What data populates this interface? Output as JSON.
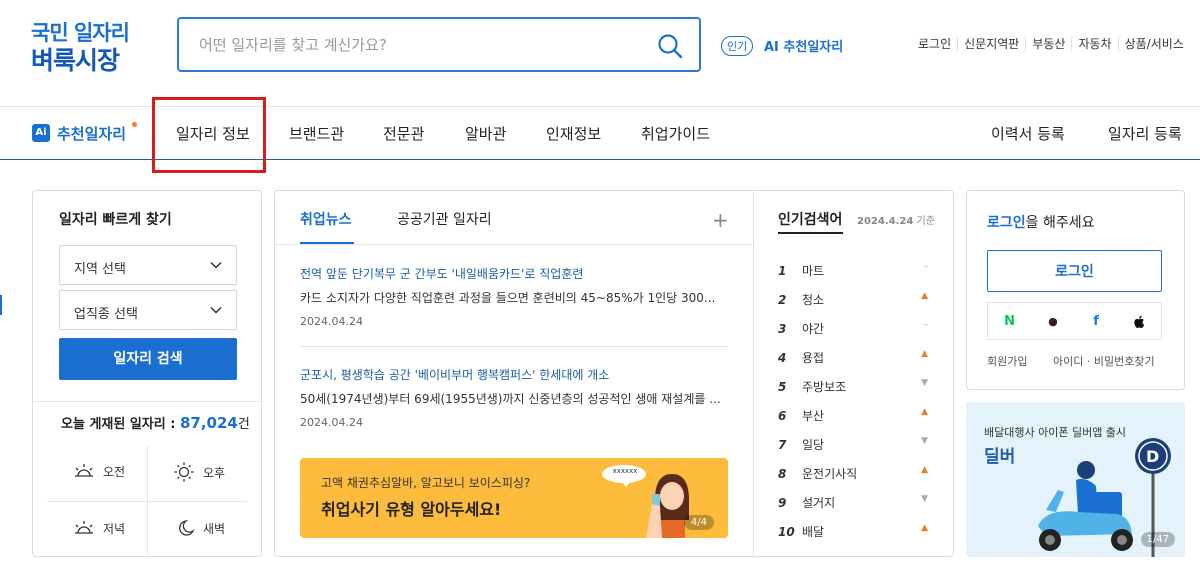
{
  "logo": {
    "line1": "국민 일자리",
    "line2": "벼룩시장"
  },
  "search": {
    "placeholder": "어떤 일자리를 찾고 계신가요?"
  },
  "ai_recommend": {
    "badge": "인기",
    "label": "AI 추천일자리"
  },
  "top_links": [
    "로그인",
    "신문지역판",
    "부동산",
    "자동차",
    "상품/서비스"
  ],
  "nav": {
    "ai_label": "추천일자리",
    "ai_box": "Ai",
    "items": [
      "일자리 정보",
      "브랜드관",
      "전문관",
      "알바관",
      "인재정보",
      "취업가이드"
    ],
    "right": [
      "이력서 등록",
      "일자리 등록"
    ]
  },
  "quick_search": {
    "title": "일자리 빠르게 찾기",
    "region": "지역 선택",
    "job_type": "업직종 선택",
    "button": "일자리 검색",
    "today_label": "오늘 게재된 일자리 : ",
    "today_count": "87,024",
    "today_unit": "건",
    "times": [
      "오전",
      "오후",
      "저녁",
      "새벽"
    ]
  },
  "news": {
    "tabs": [
      "취업뉴스",
      "공공기관 일자리"
    ],
    "plus": "+",
    "items": [
      {
        "headline": "전역 앞둔 단기복무 군 간부도 '내일배움카드'로 직업훈련",
        "body": "카드 소지자가 다양한 직업훈련 과정을 들으면 훈련비의 45~85%가 1인당 300...",
        "date": "2024.04.24"
      },
      {
        "headline": "군포시, 평생학습 공간 '베이비부머 행복캠퍼스' 한세대에 개소",
        "body": "50세(1974년생)부터 69세(1955년생)까지 신중년층의 성공적인 생애 재설계를 ...",
        "date": "2024.04.24"
      }
    ],
    "banner": {
      "line1": "고액 채권추심알바, 알고보니 보이스피싱?",
      "line2": "취업사기 유형 알아두세요!",
      "bubble": "xxxxxx",
      "page": "4/4"
    }
  },
  "ranking": {
    "title": "인기검색어",
    "date": "2024.4.24",
    "date_suffix": "기준",
    "items": [
      {
        "rank": "1",
        "term": "마트",
        "status": "–"
      },
      {
        "rank": "2",
        "term": "청소",
        "status": "▲"
      },
      {
        "rank": "3",
        "term": "야간",
        "status": "–"
      },
      {
        "rank": "4",
        "term": "용접",
        "status": "▲"
      },
      {
        "rank": "5",
        "term": "주방보조",
        "status": "▼"
      },
      {
        "rank": "6",
        "term": "부산",
        "status": "▲"
      },
      {
        "rank": "7",
        "term": "일당",
        "status": "▼"
      },
      {
        "rank": "8",
        "term": "운전기사직",
        "status": "▲"
      },
      {
        "rank": "9",
        "term": "설거지",
        "status": "▼"
      },
      {
        "rank": "10",
        "term": "배달",
        "status": "▲"
      }
    ]
  },
  "login_box": {
    "title_highlight": "로그인",
    "title_rest": "을 해주세요",
    "button": "로그인",
    "social": [
      "N",
      "●",
      "f",
      ""
    ],
    "signup": "회원가입",
    "find": "아이디 · 비밀번호찾기"
  },
  "ad": {
    "sub": "배달대행사 아이폰 딜버앱 출시",
    "title": "딜버",
    "page": "1/47"
  }
}
